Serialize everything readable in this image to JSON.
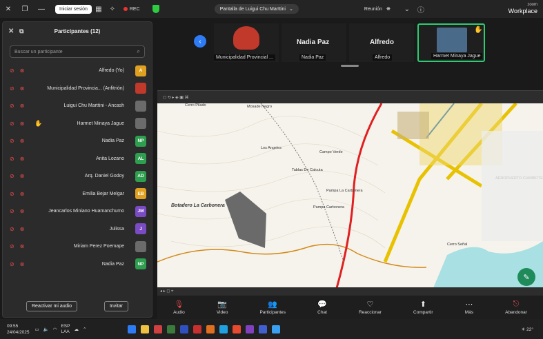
{
  "topbar": {
    "signin_label": "Iniciar sesión",
    "rec_label": "REC",
    "share_chip": "Pantalla de Luigui Chu Marttini",
    "meeting_label": "Reunión",
    "brand_line1": "zoom",
    "brand_line2": "Workplace"
  },
  "panel": {
    "title": "Participantes (12)",
    "search_placeholder": "Buscar un participante",
    "participants": [
      {
        "initials": "A",
        "color": "#e0a020",
        "name": "Alfredo (Yo)"
      },
      {
        "initials": "",
        "color": "#c0392b",
        "name": "Municipalidad Provincia... (Anfitrión)"
      },
      {
        "initials": "",
        "color": "#6b6b6b",
        "name": "Luigui Chu Marttini - Ancash"
      },
      {
        "initials": "",
        "color": "#6b6b6b",
        "name": "Harmet Minaya Jague"
      },
      {
        "initials": "NP",
        "color": "#2e9e4f",
        "name": "Nadia Paz"
      },
      {
        "initials": "AL",
        "color": "#2e9e4f",
        "name": "Anita Lozano"
      },
      {
        "initials": "AD",
        "color": "#2e9e4f",
        "name": "Arq. Daniel Godoy"
      },
      {
        "initials": "EB",
        "color": "#e0a020",
        "name": "Emilia Bejar Melgar"
      },
      {
        "initials": "JM",
        "color": "#7b4bc4",
        "name": "Jeancarlos Miniano Huamanchumo"
      },
      {
        "initials": "J",
        "color": "#7b4bc4",
        "name": "Julissa"
      },
      {
        "initials": "",
        "color": "#6b6b6b",
        "name": "Miriam Perez Poemape"
      },
      {
        "initials": "NP",
        "color": "#2e9e4f",
        "name": "Nadia Paz"
      }
    ],
    "unmute_label": "Reactivar mi audio",
    "invite_label": "Invitar"
  },
  "strip": {
    "tile1_name": "Harmet Minaya Jague",
    "tile2_big": "Alfredo",
    "tile2_name": "Alfredo",
    "tile3_big": "Nadia Paz",
    "tile3_name": "Nadia Paz",
    "tile4_name": "Municipalidad Provincial ..."
  },
  "map": {
    "labels": [
      "Mosade Negro",
      "Los Angeles",
      "Campo Verde",
      "Tablas De Calcuta",
      "Pampa La Carbonera",
      "Pampa Carbonera",
      "Botadero La Carbonera",
      "AEROPUERTO CHIMBOTE",
      "Cerro Señal",
      "Cerro Pilado"
    ]
  },
  "controls": {
    "items": [
      "Audio",
      "Video",
      "Participantes",
      "Chat",
      "Reaccionar",
      "Compartir",
      "Más",
      "Abandonar"
    ],
    "participants_count": "12"
  },
  "taskbar": {
    "time": "09:55",
    "date": "24/04/2025",
    "lang": "ESP",
    "lang2": "LAA",
    "weather": "22°"
  }
}
